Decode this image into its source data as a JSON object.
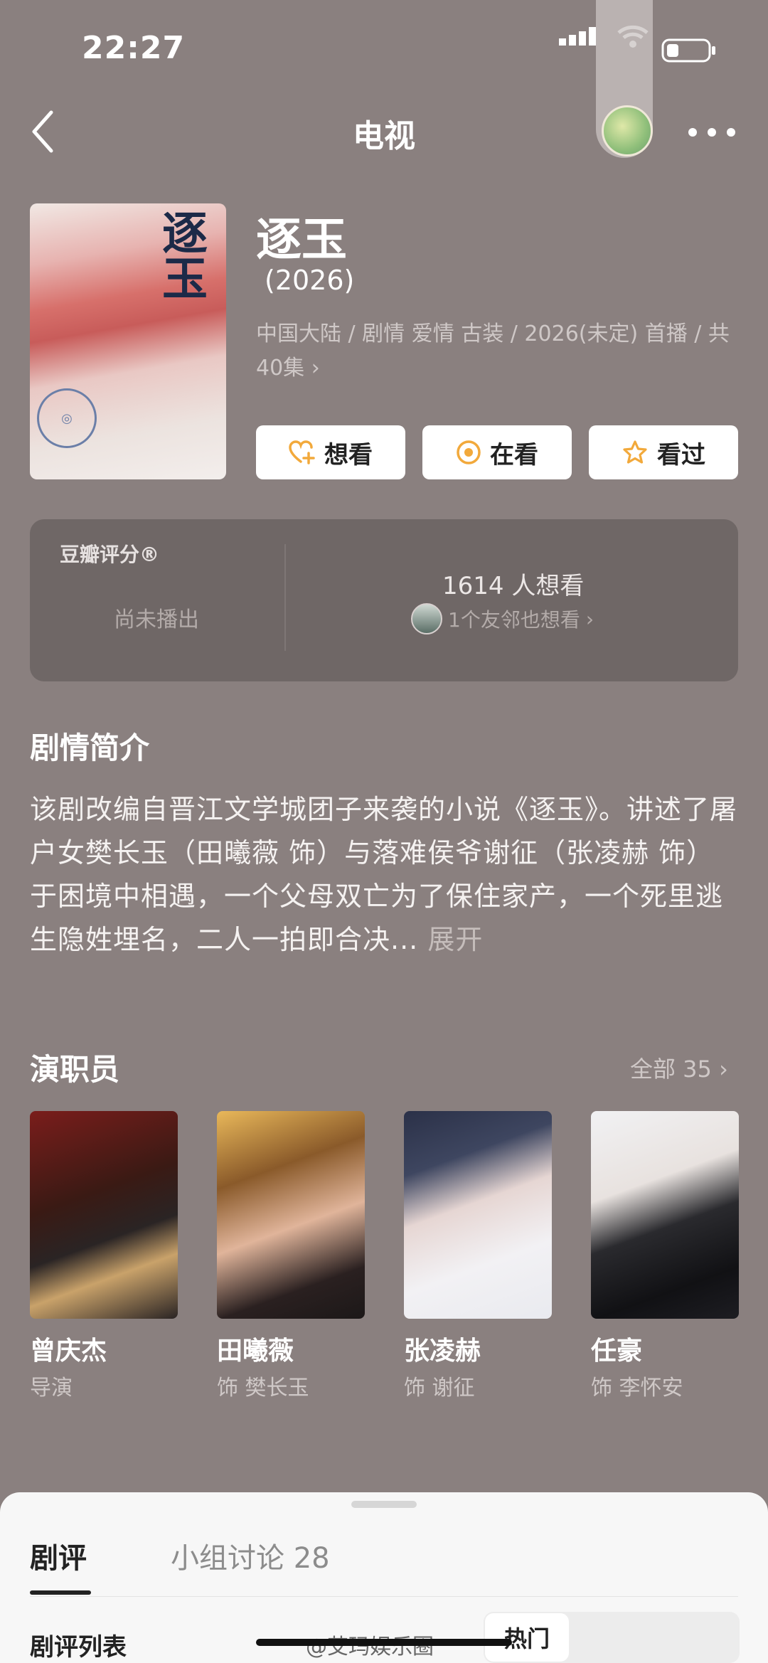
{
  "status_bar": {
    "time": "22:27"
  },
  "nav": {
    "title": "电视"
  },
  "show": {
    "poster_title": "逐玉",
    "title": "逐玉",
    "year": "(2026)",
    "meta": "中国大陆 / 剧情 爱情 古装 / 2026(未定) 首播 / 共40集"
  },
  "actions": [
    {
      "label": "想看",
      "icon": "heart-plus-icon"
    },
    {
      "label": "在看",
      "icon": "target-icon"
    },
    {
      "label": "看过",
      "icon": "star-icon"
    }
  ],
  "rating": {
    "title": "豆瓣评分®",
    "status": "尚未播出",
    "want_count": "1614 人想看",
    "friends": "1个友邻也想看"
  },
  "intro": {
    "heading": "剧情简介",
    "text": "该剧改编自晋江文学城团子来袭的小说《逐玉》。讲述了屠户女樊长玉（田曦薇 饰）与落难侯爷谢征（张凌赫 饰）于困境中相遇，一个父母双亡为了保住家产，一个死里逃生隐姓埋名，二人一拍即合决...",
    "expand": "展开"
  },
  "cast": {
    "heading": "演职员",
    "all_label": "全部 35",
    "members": [
      {
        "name": "曾庆杰",
        "role": "导演"
      },
      {
        "name": "田曦薇",
        "role": "饰 樊长玉"
      },
      {
        "name": "张凌赫",
        "role": "饰 谢征"
      },
      {
        "name": "任豪",
        "role": "饰 李怀安"
      }
    ]
  },
  "bottom_sheet": {
    "tabs": [
      {
        "label": "剧评"
      },
      {
        "label": "小组讨论 28"
      }
    ],
    "list_title": "剧评列表",
    "sort_active": "热门",
    "watermark": "@艾玛娱乐圈"
  }
}
